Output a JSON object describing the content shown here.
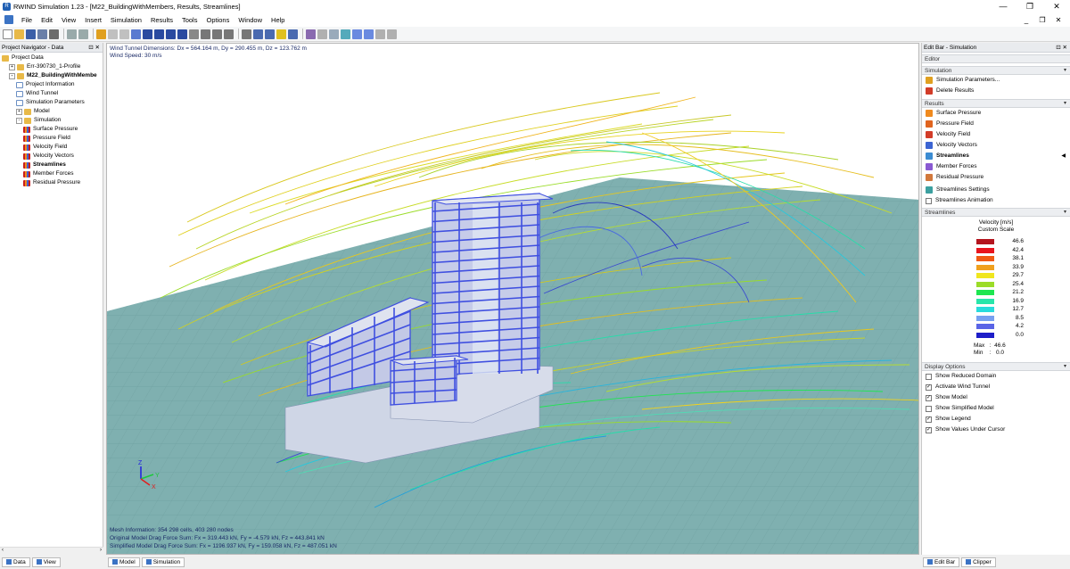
{
  "window": {
    "title": "RWIND Simulation 1.23 - [M22_BuildingWithMembers, Results, Streamlines]",
    "controls": [
      "—",
      "❐",
      "✕"
    ]
  },
  "menu": {
    "items": [
      "File",
      "Edit",
      "View",
      "Insert",
      "Simulation",
      "Results",
      "Tools",
      "Options",
      "Window",
      "Help"
    ],
    "mdi_controls": [
      "_",
      "❐",
      "✕"
    ]
  },
  "navigator": {
    "title": "Project Navigator - Data",
    "controls": "⊡ ✕",
    "tree": [
      {
        "label": "Project Data",
        "indent": 0,
        "exp": "",
        "icon": "folder",
        "bold": false
      },
      {
        "label": "Err-390730_1-Profile",
        "indent": 1,
        "exp": "+",
        "icon": "folder",
        "bold": false
      },
      {
        "label": "M22_BuildingWithMembe",
        "indent": 1,
        "exp": "-",
        "icon": "folder",
        "bold": true
      },
      {
        "label": "Project Information",
        "indent": 2,
        "exp": "",
        "icon": "doc",
        "bold": false
      },
      {
        "label": "Wind Tunnel",
        "indent": 2,
        "exp": "",
        "icon": "doc",
        "bold": false
      },
      {
        "label": "Simulation Parameters",
        "indent": 2,
        "exp": "",
        "icon": "doc",
        "bold": false
      },
      {
        "label": "Model",
        "indent": 2,
        "exp": "+",
        "icon": "folder",
        "bold": false
      },
      {
        "label": "Simulation",
        "indent": 2,
        "exp": "-",
        "icon": "folder",
        "bold": false
      },
      {
        "label": "Surface Pressure",
        "indent": 3,
        "exp": "",
        "icon": "sim",
        "bold": false
      },
      {
        "label": "Pressure Field",
        "indent": 3,
        "exp": "",
        "icon": "sim",
        "bold": false
      },
      {
        "label": "Velocity Field",
        "indent": 3,
        "exp": "",
        "icon": "sim",
        "bold": false
      },
      {
        "label": "Velocity Vectors",
        "indent": 3,
        "exp": "",
        "icon": "sim",
        "bold": false
      },
      {
        "label": "Streamlines",
        "indent": 3,
        "exp": "",
        "icon": "sim",
        "bold": true
      },
      {
        "label": "Member Forces",
        "indent": 3,
        "exp": "",
        "icon": "sim",
        "bold": false
      },
      {
        "label": "Residual Pressure",
        "indent": 3,
        "exp": "",
        "icon": "sim",
        "bold": false
      }
    ],
    "tabs": [
      "Data",
      "View"
    ]
  },
  "viewport": {
    "info_top": [
      "Wind Tunnel Dimensions: Dx = 564.164 m, Dy = 290.455 m, Dz = 123.762 m",
      "Wind Speed: 30 m/s"
    ],
    "info_bottom": [
      "Mesh Information: 354 298 cells, 403 280 nodes",
      "Original Model Drag Force Sum: Fx = 319.443 kN, Fy = -4.579 kN, Fz = 443.841 kN",
      "Simplified Model Drag Force Sum: Fx = 1196.937 kN, Fy = 159.058 kN, Fz = 487.051 kN"
    ],
    "axes": {
      "x": "X",
      "y": "Y",
      "z": "Z"
    },
    "tabs": [
      "Model",
      "Simulation"
    ]
  },
  "editbar": {
    "title": "Edit Bar - Simulation",
    "controls": "⊡ ✕",
    "sections": {
      "editor": "Editor",
      "simulation": "Simulation",
      "results": "Results",
      "streamlines": "Streamlines",
      "display": "Display Options"
    },
    "simulation_items": [
      "Simulation Parameters...",
      "Delete Results"
    ],
    "results_items": [
      "Surface Pressure",
      "Pressure Field",
      "Velocity Field",
      "Velocity Vectors",
      "Streamlines",
      "Member Forces",
      "Residual Pressure",
      "Streamlines Settings",
      "Streamlines Animation"
    ],
    "legend": {
      "title": "Velocity [m/s]",
      "subtitle": "Custom Scale",
      "values": [
        "46.6",
        "42.4",
        "38.1",
        "33.9",
        "29.7",
        "25.4",
        "21.2",
        "16.9",
        "12.7",
        "8.5",
        "4.2",
        "0.0"
      ],
      "colors": [
        "#b4141e",
        "#e8141e",
        "#f05a14",
        "#f0a01e",
        "#f0e61e",
        "#9bdc28",
        "#1ee650",
        "#28e6aa",
        "#28dcdc",
        "#78a0f0",
        "#5a64e6",
        "#1e1ec8"
      ],
      "max_label": "Max",
      "min_label": "Min",
      "max": "46.6",
      "min": "0.0"
    },
    "display_options": [
      {
        "label": "Show Reduced Domain",
        "checked": false
      },
      {
        "label": "Activate Wind Tunnel",
        "checked": true
      },
      {
        "label": "Show Model",
        "checked": true
      },
      {
        "label": "Show Simplified Model",
        "checked": false
      },
      {
        "label": "Show Legend",
        "checked": true
      },
      {
        "label": "Show Values Under Cursor",
        "checked": true
      }
    ],
    "tabs": [
      "Edit Bar",
      "Clipper"
    ]
  },
  "colors": {
    "ground": "#7fb0b0",
    "building": "#3f4fe0",
    "accent": "#1f5fb4"
  }
}
